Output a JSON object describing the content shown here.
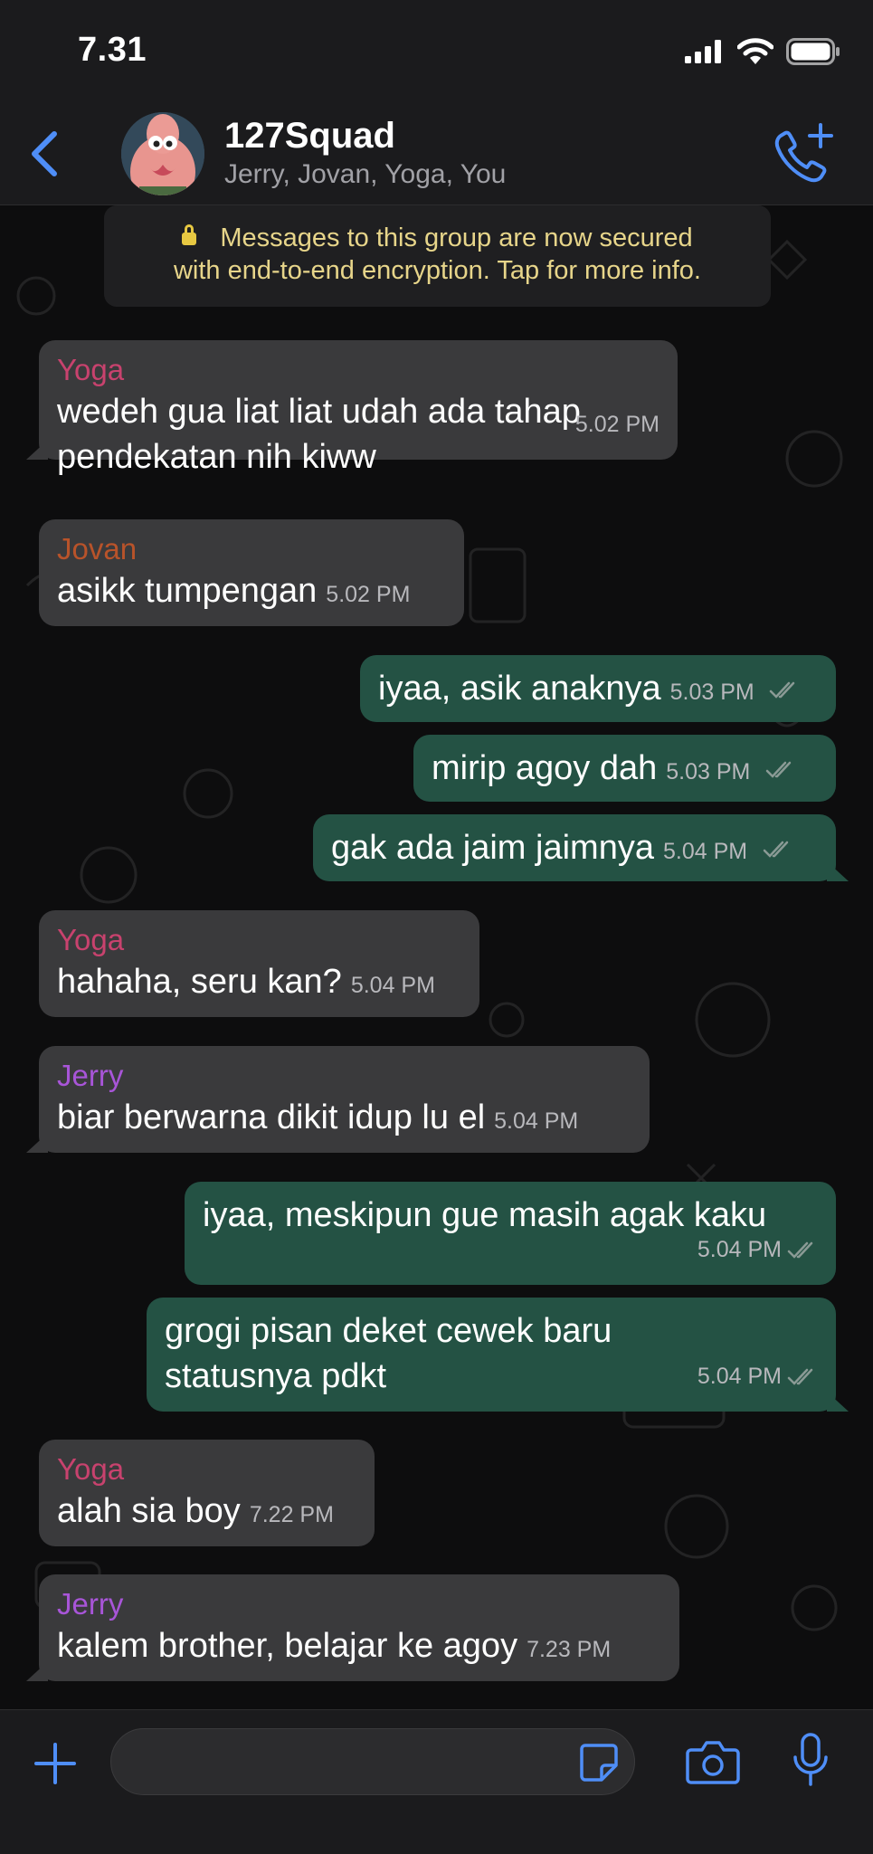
{
  "status": {
    "time": "7.31"
  },
  "header": {
    "title": "127Squad",
    "members": "Jerry, Jovan, Yoga, You"
  },
  "system_notice": {
    "line1": "Messages to this group are now secured",
    "line2": "with end-to-end encryption. Tap for more info."
  },
  "messages": [
    {
      "sender": "Yoga",
      "line1": "wedeh gua liat liat udah ada tahap",
      "line2": "pendekatan nih kiww",
      "time": "5.02 PM"
    },
    {
      "sender": "Jovan",
      "text": "asikk tumpengan",
      "time": "5.02 PM"
    },
    {
      "text": "iyaa, asik anaknya",
      "time": "5.03 PM"
    },
    {
      "text": "mirip agoy dah",
      "time": "5.03 PM"
    },
    {
      "text": "gak ada jaim jaimnya",
      "time": "5.04 PM"
    },
    {
      "sender": "Yoga",
      "text": "hahaha, seru kan?",
      "time": "5.04 PM"
    },
    {
      "sender": "Jerry",
      "text": "biar berwarna dikit idup lu el",
      "time": "5.04 PM"
    },
    {
      "text": "iyaa, meskipun gue masih agak kaku",
      "time": "5.04 PM"
    },
    {
      "line1": "grogi pisan deket cewek baru",
      "line2": "statusnya pdkt",
      "time": "5.04 PM"
    },
    {
      "sender": "Yoga",
      "text": "alah sia boy",
      "time": "7.22 PM"
    },
    {
      "sender": "Jerry",
      "text": "kalem brother, belajar ke agoy",
      "time": "7.23 PM"
    }
  ],
  "colors": {
    "yoga": "#c8426e",
    "jovan": "#b8532a",
    "jerry": "#a855d8",
    "accent": "#4f8ef7",
    "incoming": "#3a3a3c",
    "outgoing": "#245244"
  },
  "icons": {
    "back": "chevron-left-icon",
    "call": "add-call-icon",
    "plus": "plus-icon",
    "sticker": "sticker-icon",
    "camera": "camera-icon",
    "mic": "microphone-icon"
  }
}
